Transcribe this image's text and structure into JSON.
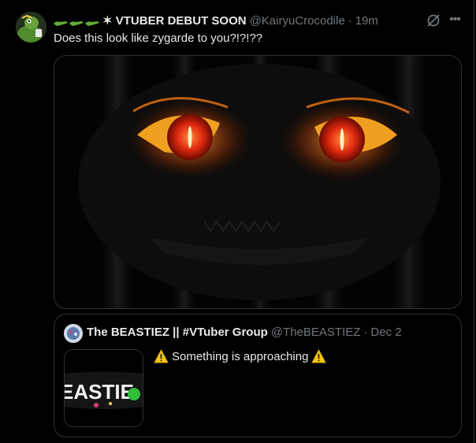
{
  "tweet": {
    "author_name": "✶ VTUBER DEBUT SOON",
    "author_handle": "@KairyuCrocodile",
    "separator": "·",
    "time": "19m",
    "text": "Does this look like zygarde to you?!?!??",
    "name_emojis": [
      "crocodile-emoji",
      "crocodile-emoji",
      "crocodile-emoji"
    ],
    "grok_icon": "grok-icon",
    "more_icon": "more-icon",
    "more_label": "•••"
  },
  "quote": {
    "author_name": "The BEASTIEZ || #VTuber Group",
    "author_handle": "@TheBEASTIEZ",
    "separator": "·",
    "date": "Dec 2",
    "text": "Something is approaching",
    "thumb_logo_text": "EASTIE",
    "warning_icon": "warning-icon"
  },
  "colors": {
    "background": "#000000",
    "text_primary": "#e7e9ea",
    "text_secondary": "#71767b",
    "border": "#2f3336",
    "eye_glow": "#ff6a00",
    "warning": "#f5c518"
  }
}
